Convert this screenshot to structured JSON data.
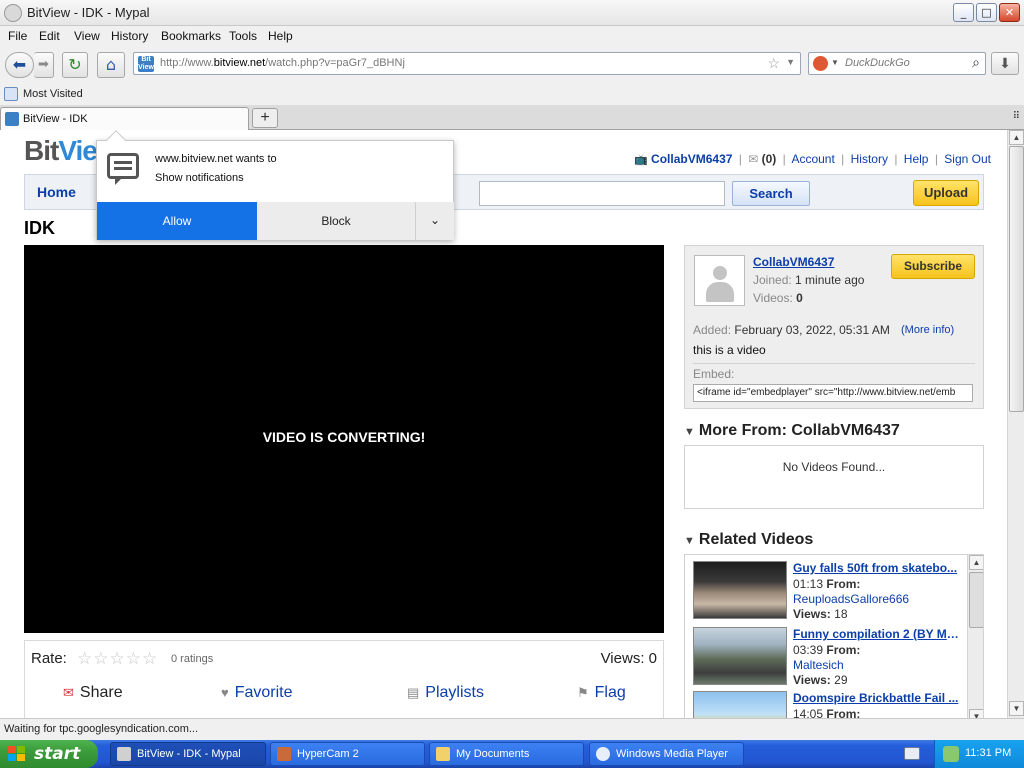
{
  "window": {
    "title": "BitView - IDK - Mypal",
    "minimize": "_",
    "maximize": "□",
    "close": "✕"
  },
  "menu": [
    "File",
    "Edit",
    "View",
    "History",
    "Bookmarks",
    "Tools",
    "Help"
  ],
  "nav": {
    "url_prefix": "http://www.",
    "url_domain": "bitview.net",
    "url_path": "/watch.php?v=paGr7_dBHNj",
    "search_placeholder": "DuckDuckGo",
    "site_icon_text": "Bit View"
  },
  "bookmarks": {
    "most_visited": "Most Visited"
  },
  "tabs": [
    {
      "label": "BitView - IDK"
    }
  ],
  "site": {
    "logo_bit": "Bit",
    "logo_view": "View",
    "user": "CollabVM6437",
    "inbox_count": "(0)",
    "links": [
      "Account",
      "History",
      "Help",
      "Sign Out"
    ],
    "nav_home": "Home",
    "search_button": "Search",
    "upload_button": "Upload"
  },
  "video": {
    "title": "IDK",
    "player_message": "VIDEO IS CONVERTING!",
    "rate_label": "Rate:",
    "stars": "☆☆☆☆☆",
    "rating": 0,
    "ratings_count": "0 ratings",
    "views_label": "Views:  0",
    "actions": {
      "share": "Share",
      "favorite": "Favorite",
      "playlists": "Playlists",
      "flag": "Flag"
    }
  },
  "channel": {
    "name": "CollabVM6437",
    "joined_label": "Joined:",
    "joined_value": "1 minute ago",
    "videos_label": "Videos:",
    "videos_value": "0",
    "subscribe": "Subscribe",
    "added_label": "Added:",
    "added_value": "February 03, 2022, 05:31 AM",
    "more_info": "(More info)",
    "description": "this is a video",
    "embed_label": "Embed:",
    "embed_code": "<iframe id=\"embedplayer\" src=\"http://www.bitview.net/emb"
  },
  "more_from": {
    "heading": "More From: CollabVM6437",
    "empty": "No Videos Found..."
  },
  "related": {
    "heading": "Related Videos",
    "items": [
      {
        "title": "Guy falls 50ft from skatebo...",
        "duration": "01:13",
        "from_label": "From:",
        "from": "ReuploadsGallore666",
        "views_label": "Views:",
        "views": "18"
      },
      {
        "title": "Funny compilation 2 (BY MA...",
        "duration": "03:39",
        "from_label": "From:",
        "from": "Maltesich",
        "views_label": "Views:",
        "views": "29"
      },
      {
        "title": "Doomspire Brickbattle Fail ...",
        "duration": "14:05",
        "from_label": "From:",
        "from": "",
        "views_label": "",
        "views": ""
      }
    ]
  },
  "notification": {
    "line1": "www.bitview.net wants to",
    "line2": "Show notifications",
    "allow": "Allow",
    "block": "Block"
  },
  "status": "Waiting for tpc.googlesyndication.com...",
  "taskbar": {
    "start": "start",
    "tasks": [
      "BitView - IDK - Mypal",
      "HyperCam 2",
      "My Documents",
      "Windows Media Player"
    ],
    "clock": "11:31 PM"
  },
  "colors": {
    "link": "#0b3ea8",
    "allow_button": "#1471e6",
    "upload_button": "#f6c31c",
    "taskbar": "#245edb"
  }
}
